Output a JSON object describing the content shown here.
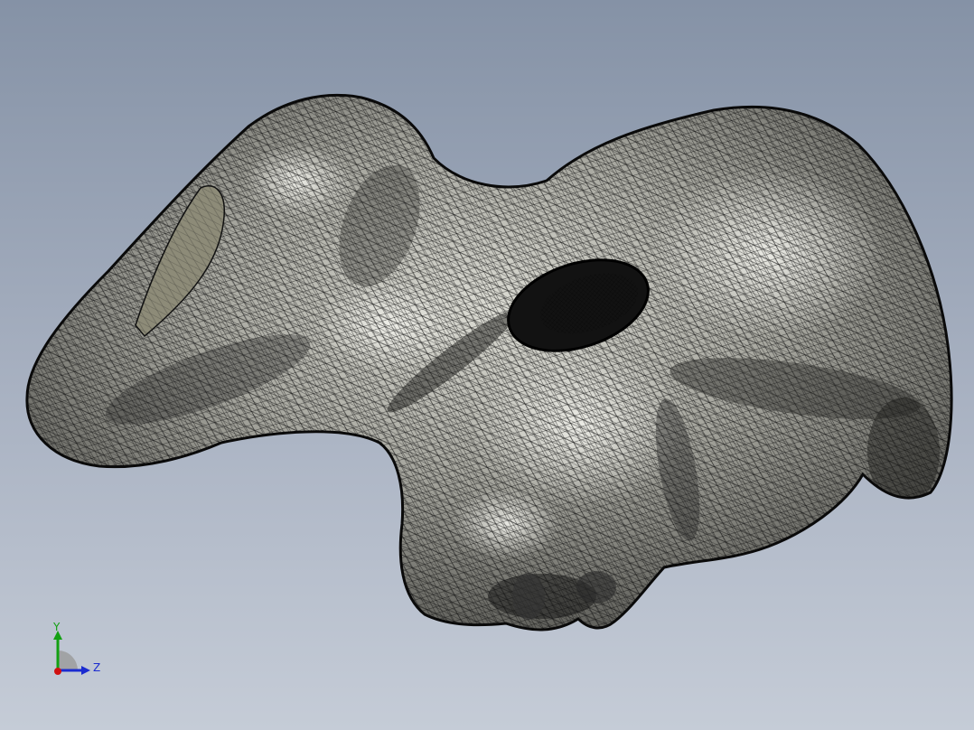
{
  "viewport": {
    "background_top": "#8592a6",
    "background_bottom": "#c5ccd7"
  },
  "model": {
    "render_mode": "shaded-with-edges",
    "body_color": "#8e8e86",
    "edge_color": "#111111",
    "end_face_color": "#8d8b78"
  },
  "triad": {
    "y_label": "Y",
    "z_label": "Z",
    "y_color": "#12a012",
    "z_color": "#1a2bd0",
    "x_color": "#d01010"
  }
}
